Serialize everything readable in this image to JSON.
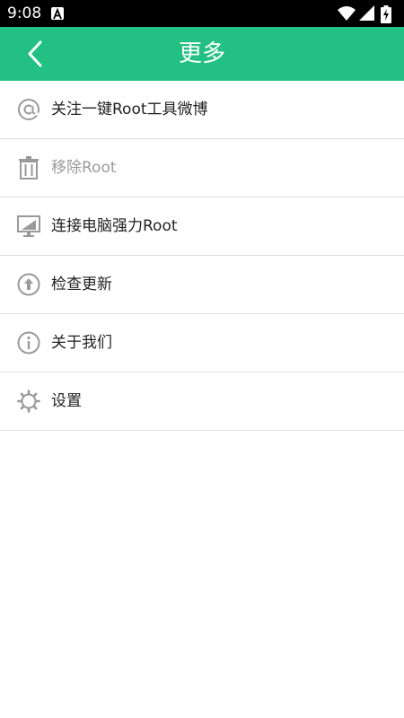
{
  "status_bar": {
    "time": "9:08",
    "app_icon": "a-icon",
    "icons": [
      "wifi-icon",
      "signal-icon",
      "battery-icon"
    ]
  },
  "app_bar": {
    "title": "更多",
    "back_icon": "chevron-left-icon",
    "color": "#22c082"
  },
  "menu": {
    "items": [
      {
        "label": "关注一键Root工具微博",
        "icon": "at-icon",
        "enabled": true
      },
      {
        "label": "移除Root",
        "icon": "trash-icon",
        "enabled": false
      },
      {
        "label": "连接电脑强力Root",
        "icon": "monitor-icon",
        "enabled": true
      },
      {
        "label": "检查更新",
        "icon": "upload-circle-icon",
        "enabled": true
      },
      {
        "label": "关于我们",
        "icon": "info-icon",
        "enabled": true
      },
      {
        "label": "设置",
        "icon": "gear-icon",
        "enabled": true
      }
    ]
  }
}
